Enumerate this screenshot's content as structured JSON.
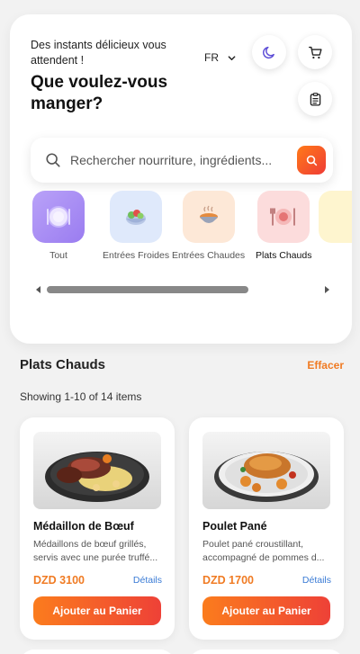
{
  "header": {
    "subtitle": "Des instants délicieux vous attendent !",
    "headline": "Que voulez-vous manger?",
    "language": "FR",
    "icons": [
      "moon-icon",
      "cart-icon",
      "clipboard-icon"
    ]
  },
  "search": {
    "placeholder": "Rechercher nourriture, ingrédients..."
  },
  "categories": [
    {
      "label": "Tout",
      "icon": "plate-icon",
      "color": "#a986f5"
    },
    {
      "label": "Entrées Froides",
      "icon": "salad-icon",
      "color": "#dfe9fb"
    },
    {
      "label": "Entrées Chaudes",
      "icon": "soup-icon",
      "color": "#fde8d7"
    },
    {
      "label": "Plats Chauds",
      "icon": "plate-cutlery-icon",
      "color": "#fcdcdc"
    },
    {
      "label": "",
      "icon": "partial-icon",
      "color": "#fef5cf"
    }
  ],
  "section": {
    "title": "Plats Chauds",
    "clear_label": "Effacer",
    "showing": "Showing 1-10 of 14 items"
  },
  "products": [
    {
      "name": "Médaillon de Bœuf",
      "desc_line1": "Médaillons de bœuf grillés,",
      "desc_line2": "servis avec une purée truffé...",
      "price": "DZD 3100",
      "details_label": "Détails",
      "add_label": "Ajouter au Panier"
    },
    {
      "name": "Poulet Pané",
      "desc_line1": "Poulet pané croustillant,",
      "desc_line2": "accompagné de pommes d...",
      "price": "DZD 1700",
      "details_label": "Détails",
      "add_label": "Ajouter au Panier"
    }
  ],
  "colors": {
    "accent": "#f07b23",
    "link": "#3a7bd5",
    "button_gradient_start": "#fb7c1d",
    "button_gradient_end": "#ee4137",
    "theme_icon": "#5b4bd6"
  }
}
